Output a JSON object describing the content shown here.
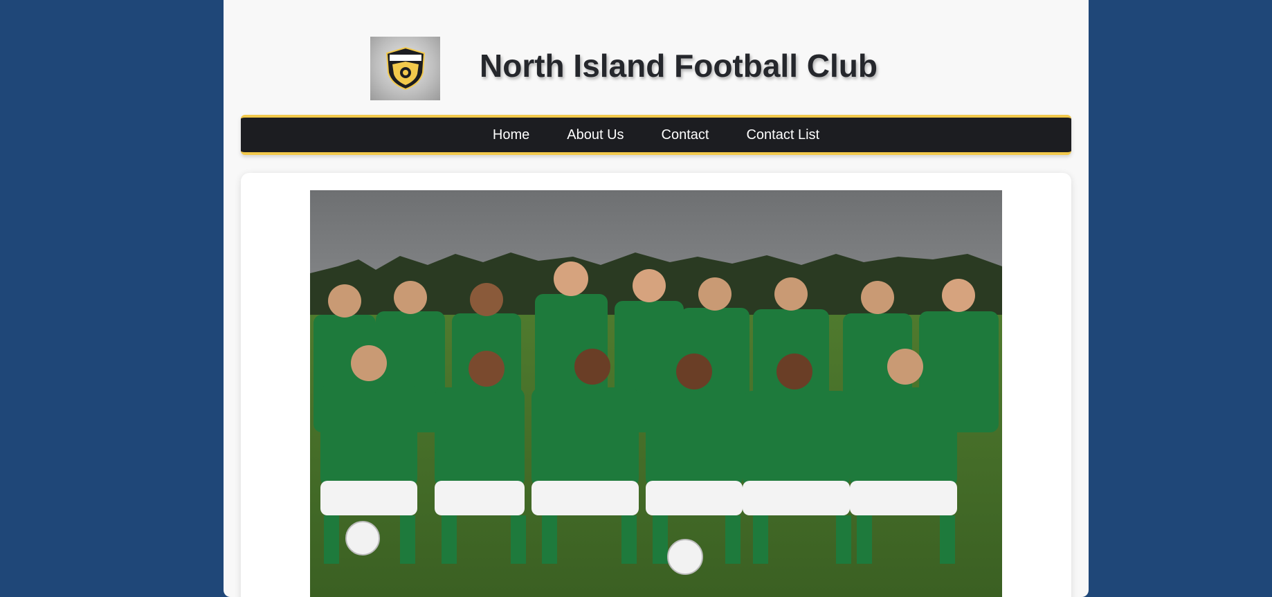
{
  "site": {
    "title": "North Island Football Club",
    "logo_icon": "club-crest-icon"
  },
  "nav": {
    "items": [
      {
        "label": "Home"
      },
      {
        "label": "About Us"
      },
      {
        "label": "Contact"
      },
      {
        "label": "Contact List"
      }
    ]
  },
  "colors": {
    "background": "#1f4778",
    "navbar": "#1c1d21",
    "accent_gold": "#f2c94c",
    "kit_green": "#1e7a3c"
  },
  "photo": {
    "subject": "team-photo"
  }
}
